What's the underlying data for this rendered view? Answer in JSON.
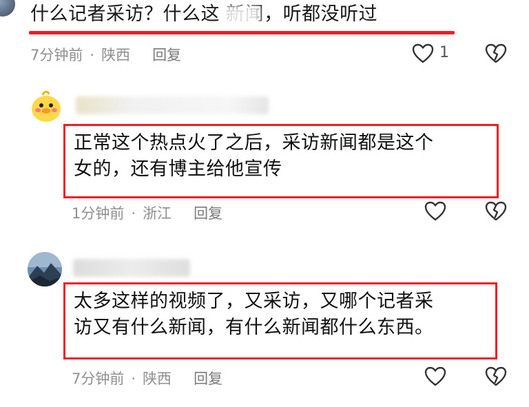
{
  "comments": [
    {
      "text": "什么记者采访？什么这 新闻，听都没听过",
      "time": "7分钟前",
      "location": "陕西",
      "reply_label": "回复",
      "like_count": "1"
    },
    {
      "text_line1": "正常这个热点火了之后，采访新闻都是这个",
      "text_line2": "女的，还有博主给他宣传",
      "time": "1分钟前",
      "location": "浙江",
      "reply_label": "回复"
    },
    {
      "text_line1": "太多这样的视频了，又采访，又哪个记者采",
      "text_line2": "访又有什么新闻，有什么新闻都什么东西。",
      "time": "7分钟前",
      "location": "陕西",
      "reply_label": "回复"
    }
  ],
  "separator": "·",
  "icons": {
    "like": "heart-outline-icon",
    "dislike": "broken-heart-icon"
  },
  "colors": {
    "highlight": "#ee1c25",
    "meta": "#8f8f8f"
  }
}
